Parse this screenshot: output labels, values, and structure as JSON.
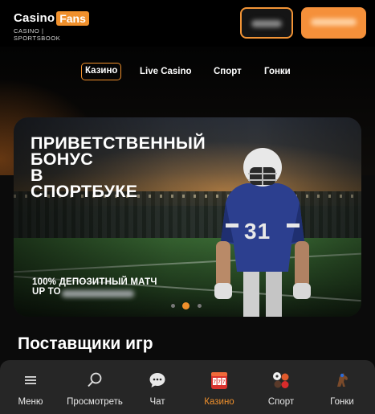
{
  "header": {
    "logo": {
      "casino": "Casino",
      "fans": "Fans",
      "tagline": "CASINO | SPORTSBOOK"
    },
    "login_button": "",
    "register_button": ""
  },
  "nav": {
    "tabs": [
      {
        "label": "Казино",
        "active": true
      },
      {
        "label": "Live Casino",
        "active": false
      },
      {
        "label": "Спорт",
        "active": false
      },
      {
        "label": "Гонки",
        "active": false
      }
    ]
  },
  "hero": {
    "title_lines": [
      "ПРИВЕТСТВЕННЫЙ",
      "БОНУС",
      "В",
      "СПОРТБУКЕ"
    ],
    "subtitle_line1": "100% ДЕПОЗИТНЫЙ МАТЧ",
    "subtitle_line2": "UP TO",
    "jersey_number": "31",
    "slides_count": 3,
    "active_slide": 2
  },
  "section": {
    "title": "Поставщики игр"
  },
  "bottom_nav": {
    "items": [
      {
        "label": "Меню",
        "icon": "menu-icon",
        "active": false
      },
      {
        "label": "Просмотреть",
        "icon": "search-icon",
        "active": false
      },
      {
        "label": "Чат",
        "icon": "chat-icon",
        "active": false
      },
      {
        "label": "Казино",
        "icon": "slot-machine-icon",
        "active": true
      },
      {
        "label": "Спорт",
        "icon": "sports-balls-icon",
        "active": false
      },
      {
        "label": "Гонки",
        "icon": "horse-racing-icon",
        "active": false
      }
    ]
  },
  "colors": {
    "accent": "#f0902c",
    "background": "#0b0b0b",
    "bottom_nav": "#262626"
  }
}
